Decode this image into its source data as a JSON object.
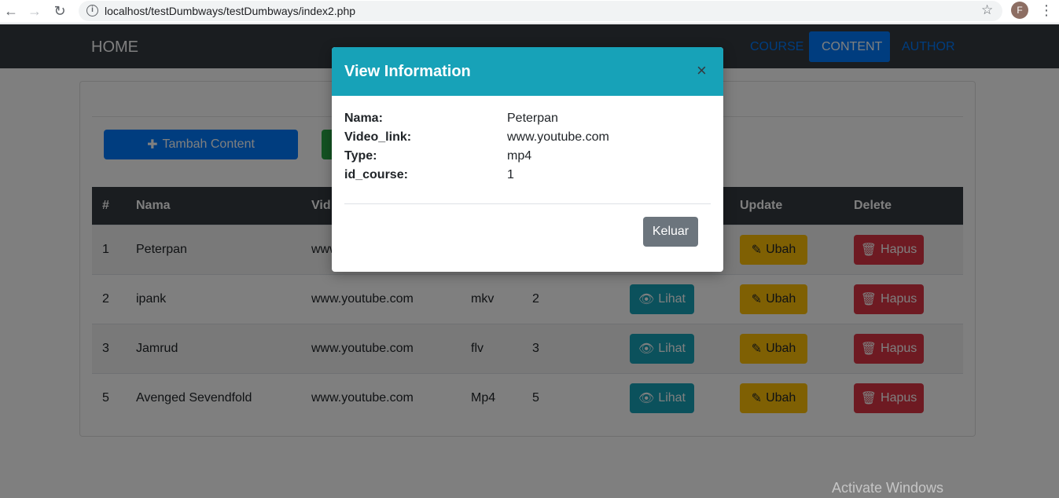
{
  "browser": {
    "url": "localhost/testDumbways/testDumbways/index2.php",
    "profile_initial": "F"
  },
  "navbar": {
    "brand": "HOME",
    "links": [
      {
        "label": "COURSE",
        "active": false
      },
      {
        "label": "CONTENT",
        "active": true
      },
      {
        "label": "AUTHOR",
        "active": false
      }
    ]
  },
  "toolbar": {
    "add_label": "Tambah Content"
  },
  "table": {
    "headers": [
      "#",
      "Nama",
      "Vid",
      "Update",
      "Delete"
    ],
    "rows": [
      {
        "no": "1",
        "nama": "Peterpan",
        "video": "www",
        "type": "",
        "course": "",
        "lihat": "",
        "ubah": "Ubah",
        "hapus": "Hapus"
      },
      {
        "no": "2",
        "nama": "ipank",
        "video": "www.youtube.com",
        "type": "mkv",
        "course": "2",
        "lihat": "Lihat",
        "ubah": "Ubah",
        "hapus": "Hapus"
      },
      {
        "no": "3",
        "nama": "Jamrud",
        "video": "www.youtube.com",
        "type": "flv",
        "course": "3",
        "lihat": "Lihat",
        "ubah": "Ubah",
        "hapus": "Hapus"
      },
      {
        "no": "5",
        "nama": "Avenged Sevendfold",
        "video": "www.youtube.com",
        "type": "Mp4",
        "course": "5",
        "lihat": "Lihat",
        "ubah": "Ubah",
        "hapus": "Hapus"
      }
    ]
  },
  "modal": {
    "title": "View Information",
    "close_symbol": "×",
    "fields": [
      {
        "key": "Nama:",
        "value": "Peterpan"
      },
      {
        "key": "Video_link:",
        "value": "www.youtube.com"
      },
      {
        "key": "Type:",
        "value": "mp4"
      },
      {
        "key": "id_course:",
        "value": "1"
      }
    ],
    "dismiss_label": "Keluar"
  },
  "watermark": "Activate Windows",
  "colors": {
    "primary": "#007bff",
    "info": "#17a2b8",
    "warning": "#ffc107",
    "danger": "#dc3545",
    "secondary": "#6c757d",
    "dark": "#343a40"
  }
}
